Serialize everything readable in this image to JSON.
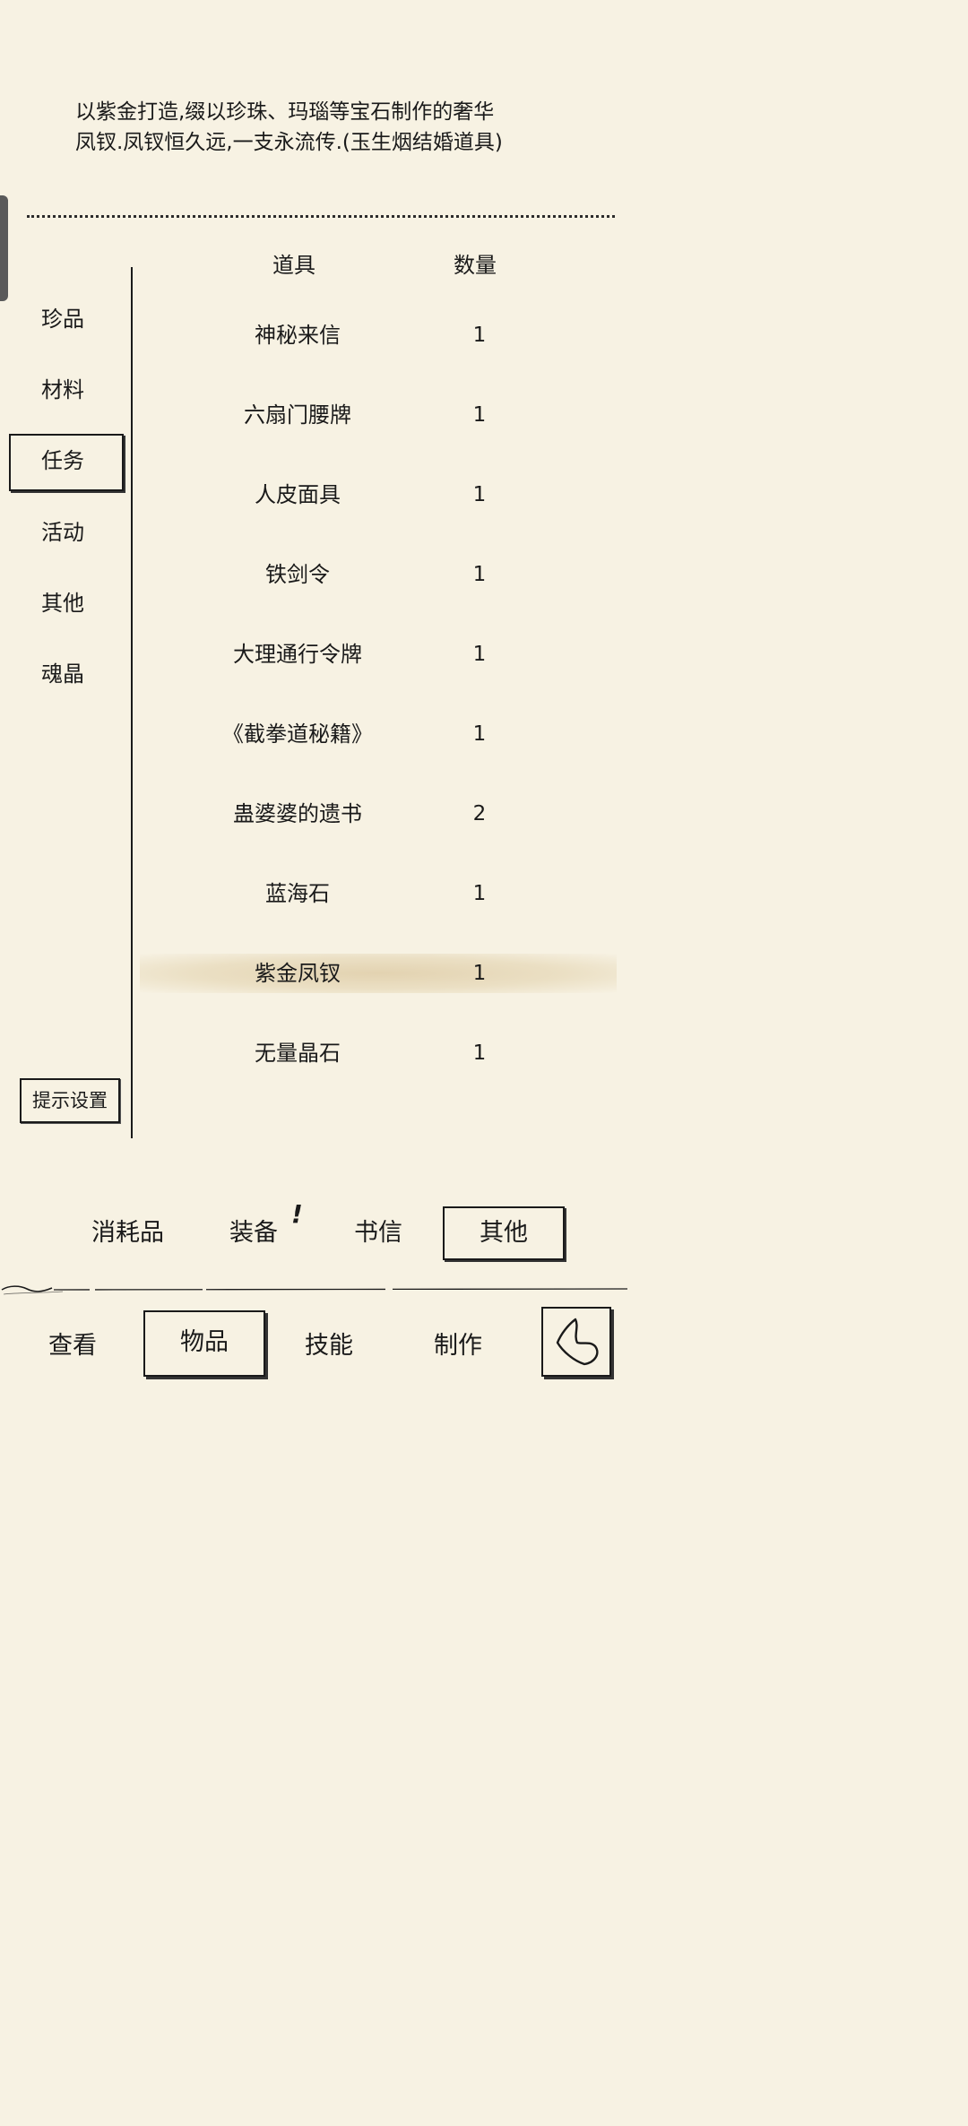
{
  "item_description": {
    "line1": "以紫金打造,缀以珍珠、玛瑙等宝石制作的奢华",
    "line2": "凤钗.凤钗恒久远,一支永流传.(玉生烟结婚道具)"
  },
  "categories": [
    {
      "label": "珍品"
    },
    {
      "label": "材料"
    },
    {
      "label": "任务"
    },
    {
      "label": "活动"
    },
    {
      "label": "其他"
    },
    {
      "label": "魂晶"
    }
  ],
  "active_category": "任务",
  "hint_settings_label": "提示设置",
  "table": {
    "headers": {
      "item": "道具",
      "quantity": "数量"
    },
    "rows": [
      {
        "name": "神秘来信",
        "qty": "1"
      },
      {
        "name": "六扇门腰牌",
        "qty": "1"
      },
      {
        "name": "人皮面具",
        "qty": "1"
      },
      {
        "name": "铁剑令",
        "qty": "1"
      },
      {
        "name": "大理通行令牌",
        "qty": "1"
      },
      {
        "name": "《截拳道秘籍》",
        "qty": "1"
      },
      {
        "name": "蛊婆婆的遗书",
        "qty": "2"
      },
      {
        "name": "蓝海石",
        "qty": "1"
      },
      {
        "name": "紫金凤钗",
        "qty": "1"
      },
      {
        "name": "无量晶石",
        "qty": "1"
      }
    ],
    "selected_item": "紫金凤钗"
  },
  "sub_tabs": [
    {
      "label": "消耗品"
    },
    {
      "label": "装备",
      "badge": "!"
    },
    {
      "label": "书信"
    },
    {
      "label": "其他"
    }
  ],
  "active_sub_tab": "其他",
  "main_tabs": [
    {
      "label": "查看"
    },
    {
      "label": "物品"
    },
    {
      "label": "技能"
    },
    {
      "label": "制作"
    }
  ],
  "active_main_tab": "物品",
  "back_button_icon": "back-arrow-icon"
}
